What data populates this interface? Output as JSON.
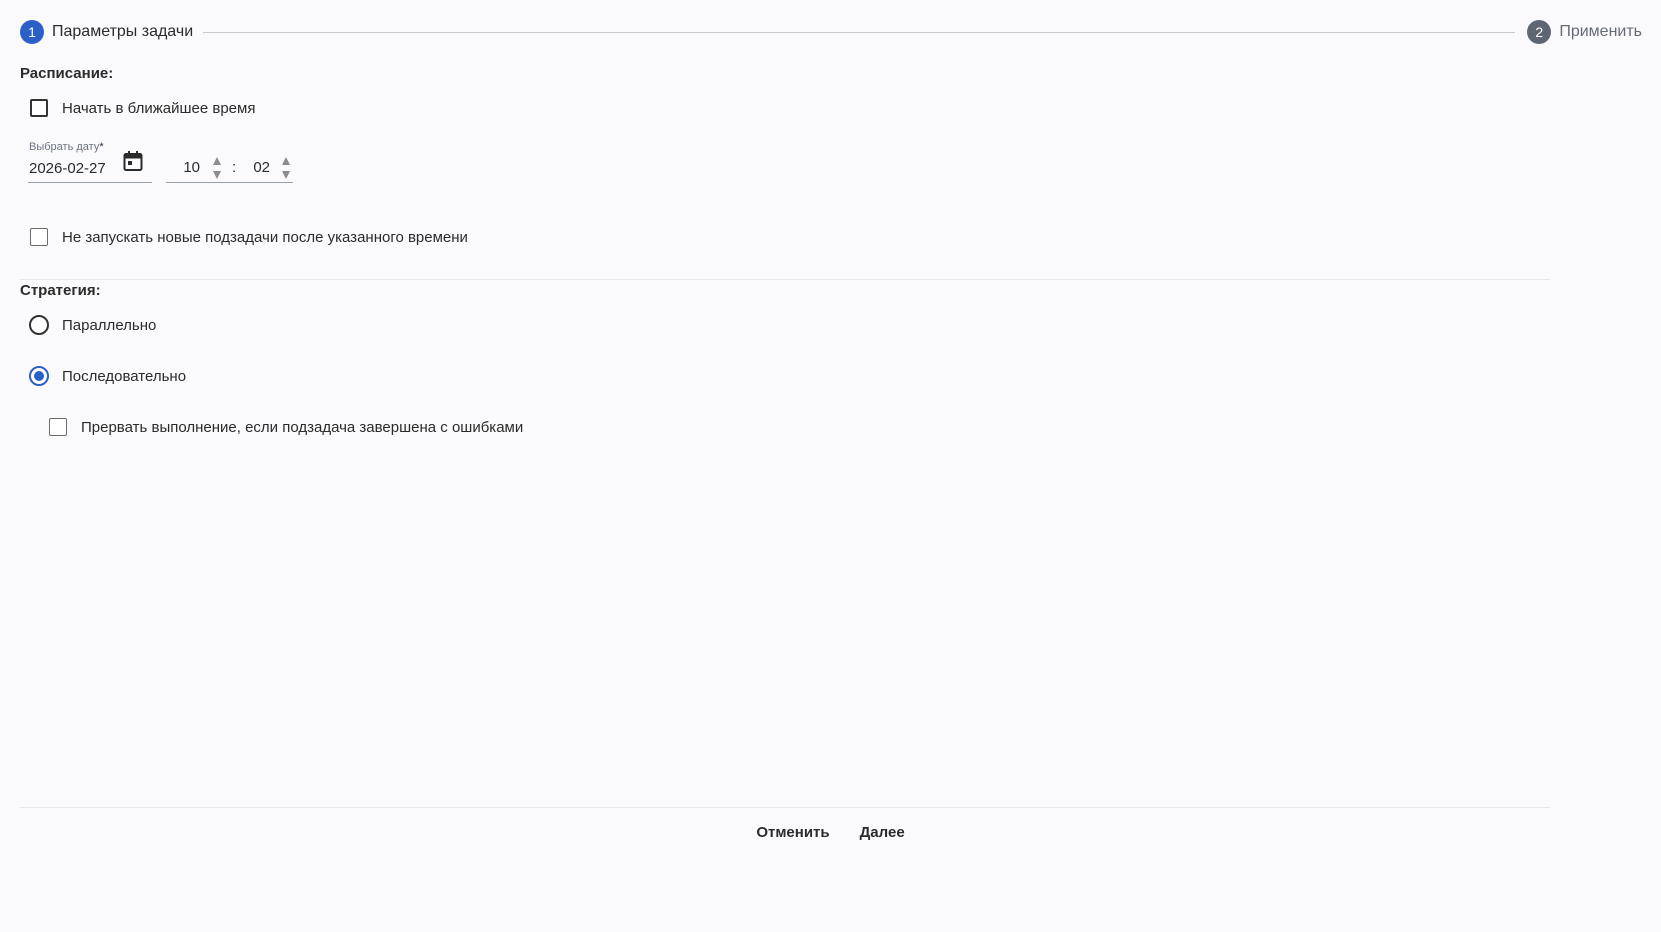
{
  "stepper": {
    "steps": [
      {
        "number": "1",
        "label": "Параметры задачи"
      },
      {
        "number": "2",
        "label": "Применить"
      }
    ]
  },
  "schedule": {
    "title": "Расписание:",
    "start_asap_label": "Начать в ближайшее время",
    "date_label": "Выбрать дату",
    "date_required_mark": "*",
    "date_value": "2026-02-27",
    "hours": "10",
    "time_separator": ":",
    "minutes": "02",
    "no_new_subtasks_label": "Не запускать новые подзадачи после указанного времени"
  },
  "strategy": {
    "title": "Стратегия:",
    "parallel_label": "Параллельно",
    "sequential_label": "Последовательно",
    "abort_on_error_label": "Прервать выполнение, если подзадача завершена с ошибками"
  },
  "footer": {
    "cancel_label": "Отменить",
    "next_label": "Далее"
  },
  "colors": {
    "accent": "#2b5fc9",
    "step_inactive": "#5f6673",
    "text": "#2b2b2b",
    "background": "#fafafc"
  },
  "icons": {
    "date_picker": "calendar-icon",
    "hours_spinner": "spinner-arrows-icon",
    "minutes_spinner": "spinner-arrows-icon"
  }
}
